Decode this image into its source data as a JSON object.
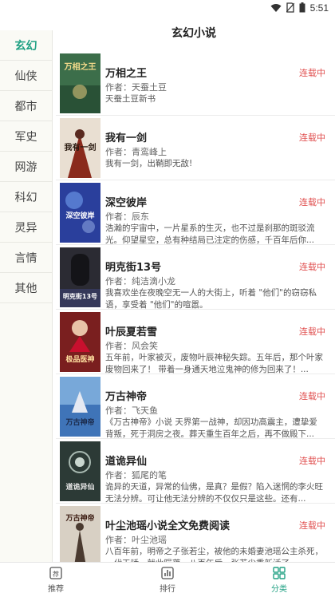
{
  "status_bar": {
    "time": "5:51",
    "icons": [
      "wifi-icon",
      "no-sim-icon",
      "battery-icon"
    ]
  },
  "header": {
    "title": "玄幻小说"
  },
  "sidebar": {
    "items": [
      {
        "label": "玄幻",
        "active": true
      },
      {
        "label": "仙侠"
      },
      {
        "label": "都市"
      },
      {
        "label": "军史"
      },
      {
        "label": "网游"
      },
      {
        "label": "科幻"
      },
      {
        "label": "灵异"
      },
      {
        "label": "言情"
      },
      {
        "label": "其他"
      }
    ]
  },
  "books": [
    {
      "title": "万相之王",
      "author": "作者：天蚕土豆",
      "status": "连载中",
      "desc": "天蚕土豆新书",
      "cover_text": "万相之王",
      "cover_color": "#3c6e4a"
    },
    {
      "title": "我有一剑",
      "author": "作者：青鸾峰上",
      "status": "连载中",
      "desc": "我有一剑，出鞘即无敌!",
      "cover_text": "我有一剑",
      "cover_color": "#8a2a1c"
    },
    {
      "title": "深空彼岸",
      "author": "作者：辰东",
      "status": "连载中",
      "desc": "浩瀚的宇宙中，一片星系的生灭，也不过是刹那的斑驳流光。仰望星空，总有种结局已注定的伤感，千百年后你...",
      "cover_text": "深空彼岸",
      "cover_color": "#2a3f9c"
    },
    {
      "title": "明克街13号",
      "author": "作者：纯洁滴小龙",
      "status": "连载中",
      "desc": "我喜欢坐在夜晚空无一人的大街上，听着 \"他们\"的窃窃私语，享受着 \"他们\"的喧嚣。",
      "cover_text": "明克街13号",
      "cover_color": "#2b2b33"
    },
    {
      "title": "叶辰夏若雪",
      "author": "作者：风会笑",
      "status": "连载中",
      "desc": "五年前，叶家被灭，废物叶辰神秘失踪。五年后，那个叶家废物回来了！ 带着一身通天地泣鬼神的修为回来了！...",
      "cover_text": "极品医神",
      "cover_color": "#7a1f1f"
    },
    {
      "title": "万古神帝",
      "author": "作者：飞天鱼",
      "status": "连载中",
      "desc": "《万古神帝》小说 天界第一战神，却因功高震主，遭挚爱背叛，死于洞房之夜。葬天重生百年之后，再不做殿下...",
      "cover_text": "万古神帝",
      "cover_color": "#3f74b8"
    },
    {
      "title": "道诡异仙",
      "author": "作者：狐尾的笔",
      "status": "连载中",
      "desc": "诡异的天道，异常的仙佛，是真？是假？陷入迷惘的李火旺无法分辨。可让他无法分辨的不仅仅只是这些。还有...",
      "cover_text": "道诡异仙",
      "cover_color": "#2c3a36"
    },
    {
      "title": "叶尘池瑶小说全文免费阅读",
      "author": "作者：叶尘池瑶",
      "status": "连载中",
      "desc": "八百年前，明帝之子张若尘，被他的未婚妻池瑶公主杀死，一代天骄，就此陨落。八百年后，张若尘重新活了...",
      "cover_text": "万古神帝",
      "cover_color": "#d8d0c4"
    }
  ],
  "tabbar": {
    "items": [
      {
        "label": "推荐",
        "icon": "recommend-icon"
      },
      {
        "label": "排行",
        "icon": "ranking-icon"
      },
      {
        "label": "分类",
        "icon": "category-icon",
        "active": true
      }
    ]
  },
  "colors": {
    "accent": "#21a184",
    "status_red": "#e05050"
  }
}
